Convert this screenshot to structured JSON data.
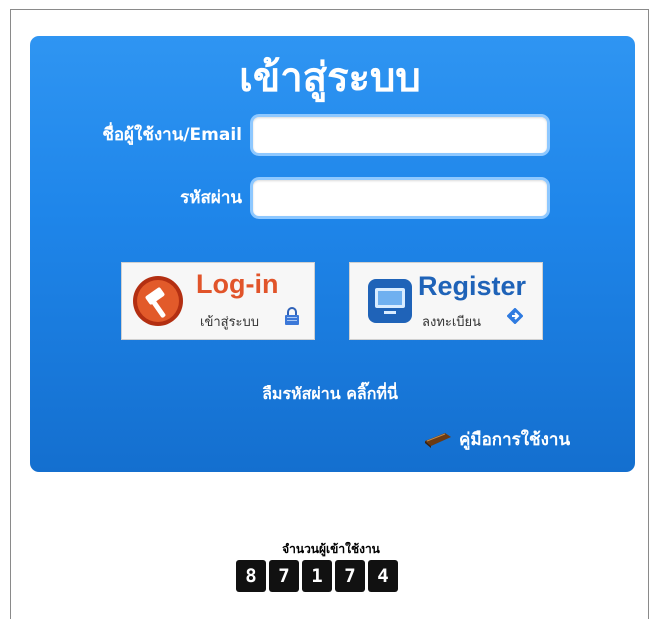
{
  "login": {
    "title": "เข้าสู่ระบบ",
    "username_label": "ชื่อผู้ใช้งาน/Email",
    "username_value": "",
    "password_label": "รหัสผ่าน",
    "password_value": "",
    "login_button": {
      "main": "Log-in",
      "sub": "เข้าสู่ระบบ",
      "icon": "gavel-icon",
      "accent": "#e1542a"
    },
    "register_button": {
      "main": "Register",
      "sub": "ลงทะเบียน",
      "icon": "monitor-icon",
      "accent": "#1f63b8"
    },
    "forgot_password": "ลืมรหัสผ่าน คลิ๊กที่นี่",
    "manual_link": "คู่มือการใช้งาน"
  },
  "counter": {
    "label": "จำนวนผู้เข้าใช้งาน",
    "digits": [
      "8",
      "7",
      "1",
      "7",
      "4"
    ]
  },
  "colors": {
    "panel": "#1f86ea",
    "field_border": "#8ec8ff"
  }
}
